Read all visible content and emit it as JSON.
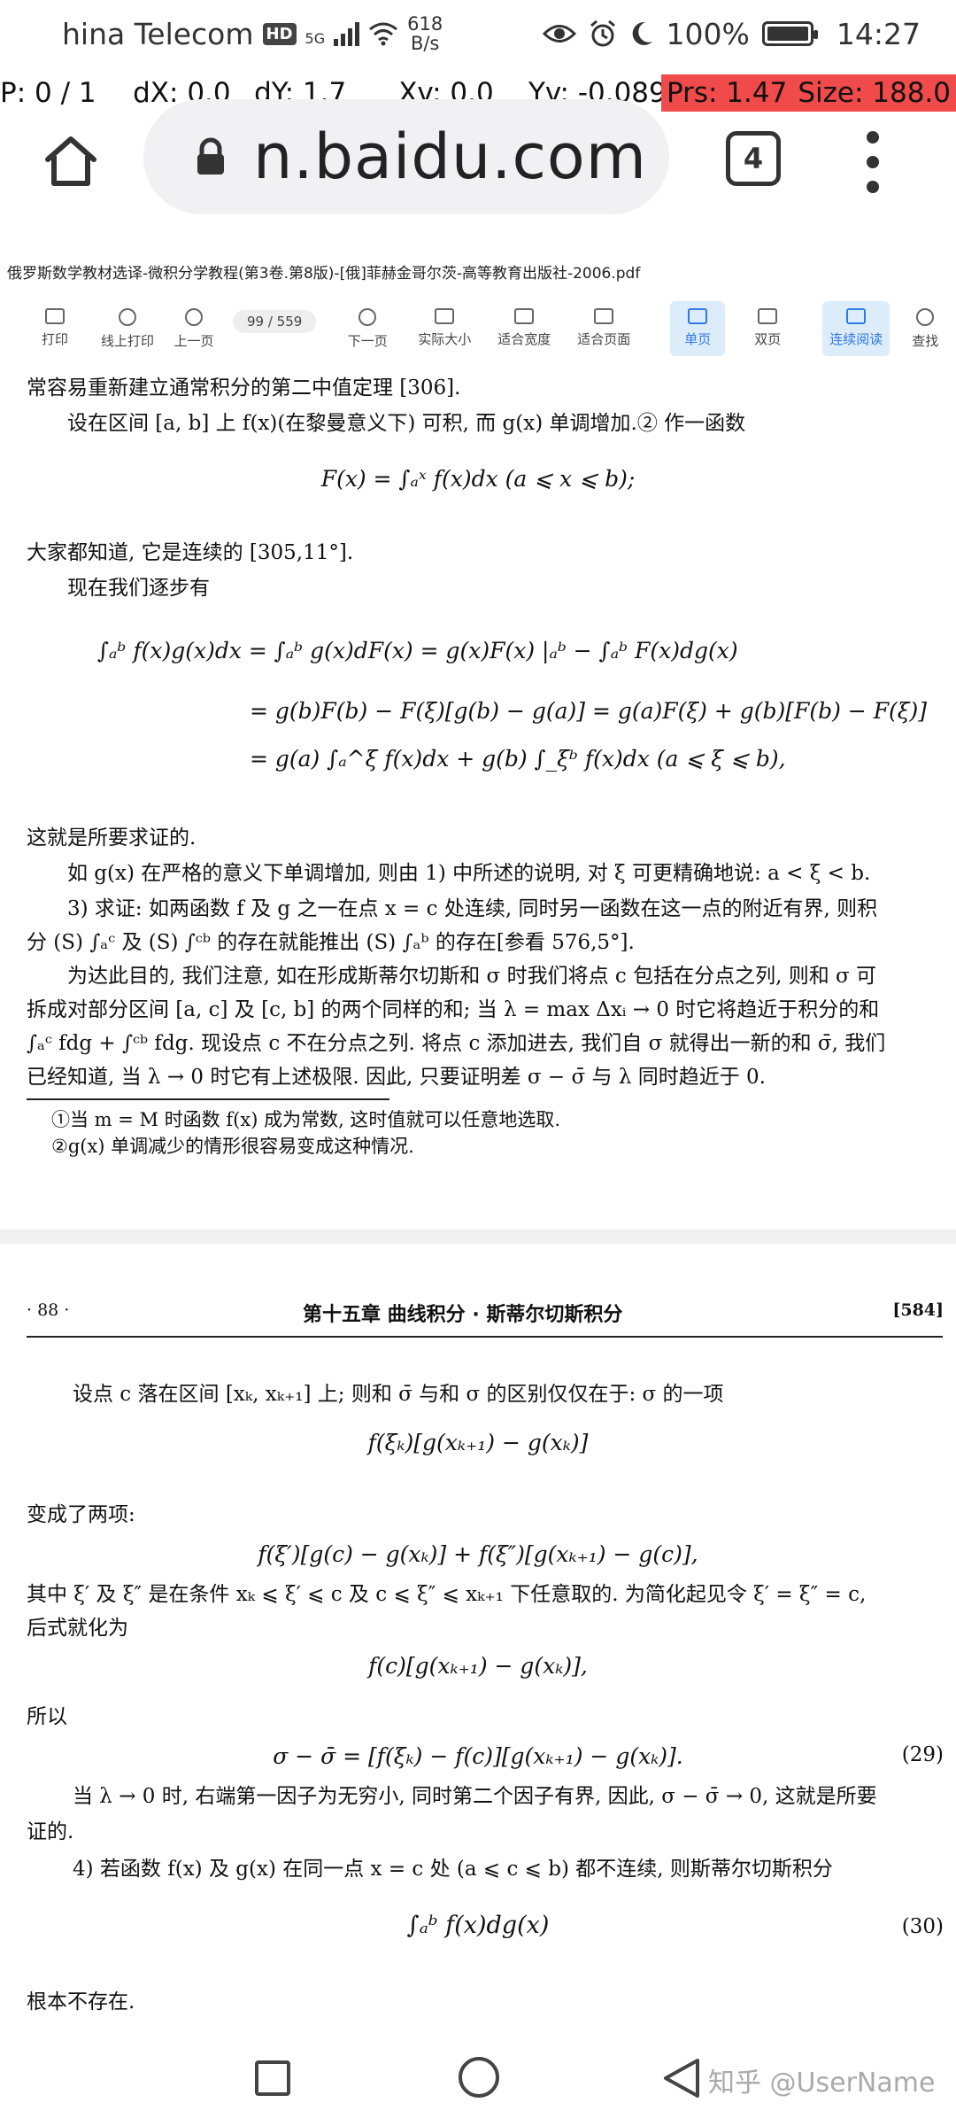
{
  "status": {
    "carrier": "hina Telecom",
    "hd": "HD",
    "net": "5G",
    "speed_value": "618",
    "speed_unit": "B/s",
    "battery": "100%",
    "time": "14:27"
  },
  "debug": {
    "p": "P: 0 / 1",
    "dx": "dX: 0.0",
    "dy": "dY: 1.7",
    "xv": "Xv: 0.0",
    "yv": "Yv: -0.089",
    "prs": "Prs: 1.47",
    "size": "Size: 188.0"
  },
  "browser": {
    "url": "n.baidu.com",
    "tab_count": "4"
  },
  "pdf": {
    "title": "俄罗斯数学教材选译-微积分学教程(第3卷.第8版)-[俄]菲赫金哥尔茨-高等教育出版社-2006.pdf",
    "toolbar": {
      "print": "打印",
      "online_print": "线上打印",
      "prev_page": "上一页",
      "page_indicator": "99 / 559",
      "next_page": "下一页",
      "actual_size": "实际大小",
      "fit_width": "适合宽度",
      "fit_page": "适合页面",
      "single_page": "单页",
      "double_page": "双页",
      "continuous": "连续阅读",
      "search": "查找"
    }
  },
  "doc": {
    "p1_l1": "常容易重新建立通常积分的第二中值定理 [306].",
    "p1_l2": "设在区间 [a, b] 上 f(x)(在黎曼意义下) 可积, 而 g(x) 单调增加.② 作一函数",
    "eq_F": "F(x) = ∫ₐˣ f(x)dx   (a ⩽ x ⩽ b);",
    "p2_l1": "大家都知道, 它是连续的 [305,11°].",
    "p2_l2": "现在我们逐步有",
    "eq1": "∫ₐᵇ f(x)g(x)dx = ∫ₐᵇ g(x)dF(x) = g(x)F(x) |ₐᵇ − ∫ₐᵇ F(x)dg(x)",
    "eq2": "= g(b)F(b) − F(ξ)[g(b) − g(a)] = g(a)F(ξ) + g(b)[F(b) − F(ξ)]",
    "eq3": "= g(a) ∫ₐ^ξ f(x)dx + g(b) ∫_ξᵇ f(x)dx    (a ⩽ ξ ⩽ b),",
    "p3_l1": "这就是所要求证的.",
    "p3_l2": "如 g(x) 在严格的意义下单调增加, 则由 1) 中所述的说明, 对 ξ 可更精确地说: a < ξ < b.",
    "p4_l1": "3) 求证: 如两函数 f 及 g 之一在点 x = c 处连续, 同时另一函数在这一点的附近有界, 则积",
    "p4_l2": "分 (S) ∫ₐᶜ 及 (S) ∫ᶜᵇ 的存在就能推出 (S) ∫ₐᵇ 的存在[参看 576,5°].",
    "p5_l1": "为达此目的, 我们注意, 如在形成斯蒂尔切斯和 σ 时我们将点 c 包括在分点之列, 则和 σ 可",
    "p5_l2": "拆成对部分区间 [a, c] 及 [c, b] 的两个同样的和; 当 λ = max Δxᵢ → 0 时它将趋近于积分的和",
    "p5_l3": "∫ₐᶜ fdg + ∫ᶜᵇ fdg. 现设点 c 不在分点之列. 将点 c 添加进去, 我们自 σ 就得出一新的和 σ̄, 我们",
    "p5_l4": "已经知道, 当 λ → 0 时它有上述极限. 因此, 只要证明差 σ − σ̄ 与 λ 同时趋近于 0.",
    "fn1": "①当 m = M 时函数 f(x) 成为常数, 这时值就可以任意地选取.",
    "fn2": "②g(x) 单调减少的情形很容易变成这种情况.",
    "page_num": "· 88 ·",
    "chapter": "第十五章  曲线积分 · 斯蒂尔切斯积分",
    "page_code": "[584]",
    "q1": "设点 c 落在区间 [xₖ, xₖ₊₁] 上; 则和 σ̄ 与和 σ 的区别仅仅在于: σ 的一项",
    "eq4": "f(ξₖ)[g(xₖ₊₁) − g(xₖ)]",
    "q2": "变成了两项:",
    "eq5": "f(ξ′)[g(c) − g(xₖ)] + f(ξ″)[g(xₖ₊₁) − g(c)],",
    "q3_l1": "其中 ξ′ 及 ξ″ 是在条件 xₖ ⩽ ξ′ ⩽ c 及 c ⩽ ξ″ ⩽ xₖ₊₁ 下任意取的. 为简化起见令 ξ′ = ξ″ = c,",
    "q3_l2": "后式就化为",
    "eq6": "f(c)[g(xₖ₊₁) − g(xₖ)],",
    "q4": "所以",
    "eq7": "σ − σ̄ = [f(ξₖ) − f(c)][g(xₖ₊₁) − g(xₖ)].",
    "eq7_num": "(29)",
    "q5_l1": "当 λ → 0 时, 右端第一因子为无穷小, 同时第二个因子有界, 因此, σ − σ̄ → 0, 这就是所要",
    "q5_l2": "证的.",
    "q6": "4) 若函数 f(x) 及 g(x) 在同一点 x = c 处 (a ⩽ c ⩽ b) 都不连续, 则斯蒂尔切斯积分",
    "eq8": "∫ₐᵇ f(x)dg(x)",
    "eq8_num": "(30)",
    "q7": "根本不存在."
  },
  "nav": {
    "watermark": "知乎 @UserName"
  }
}
